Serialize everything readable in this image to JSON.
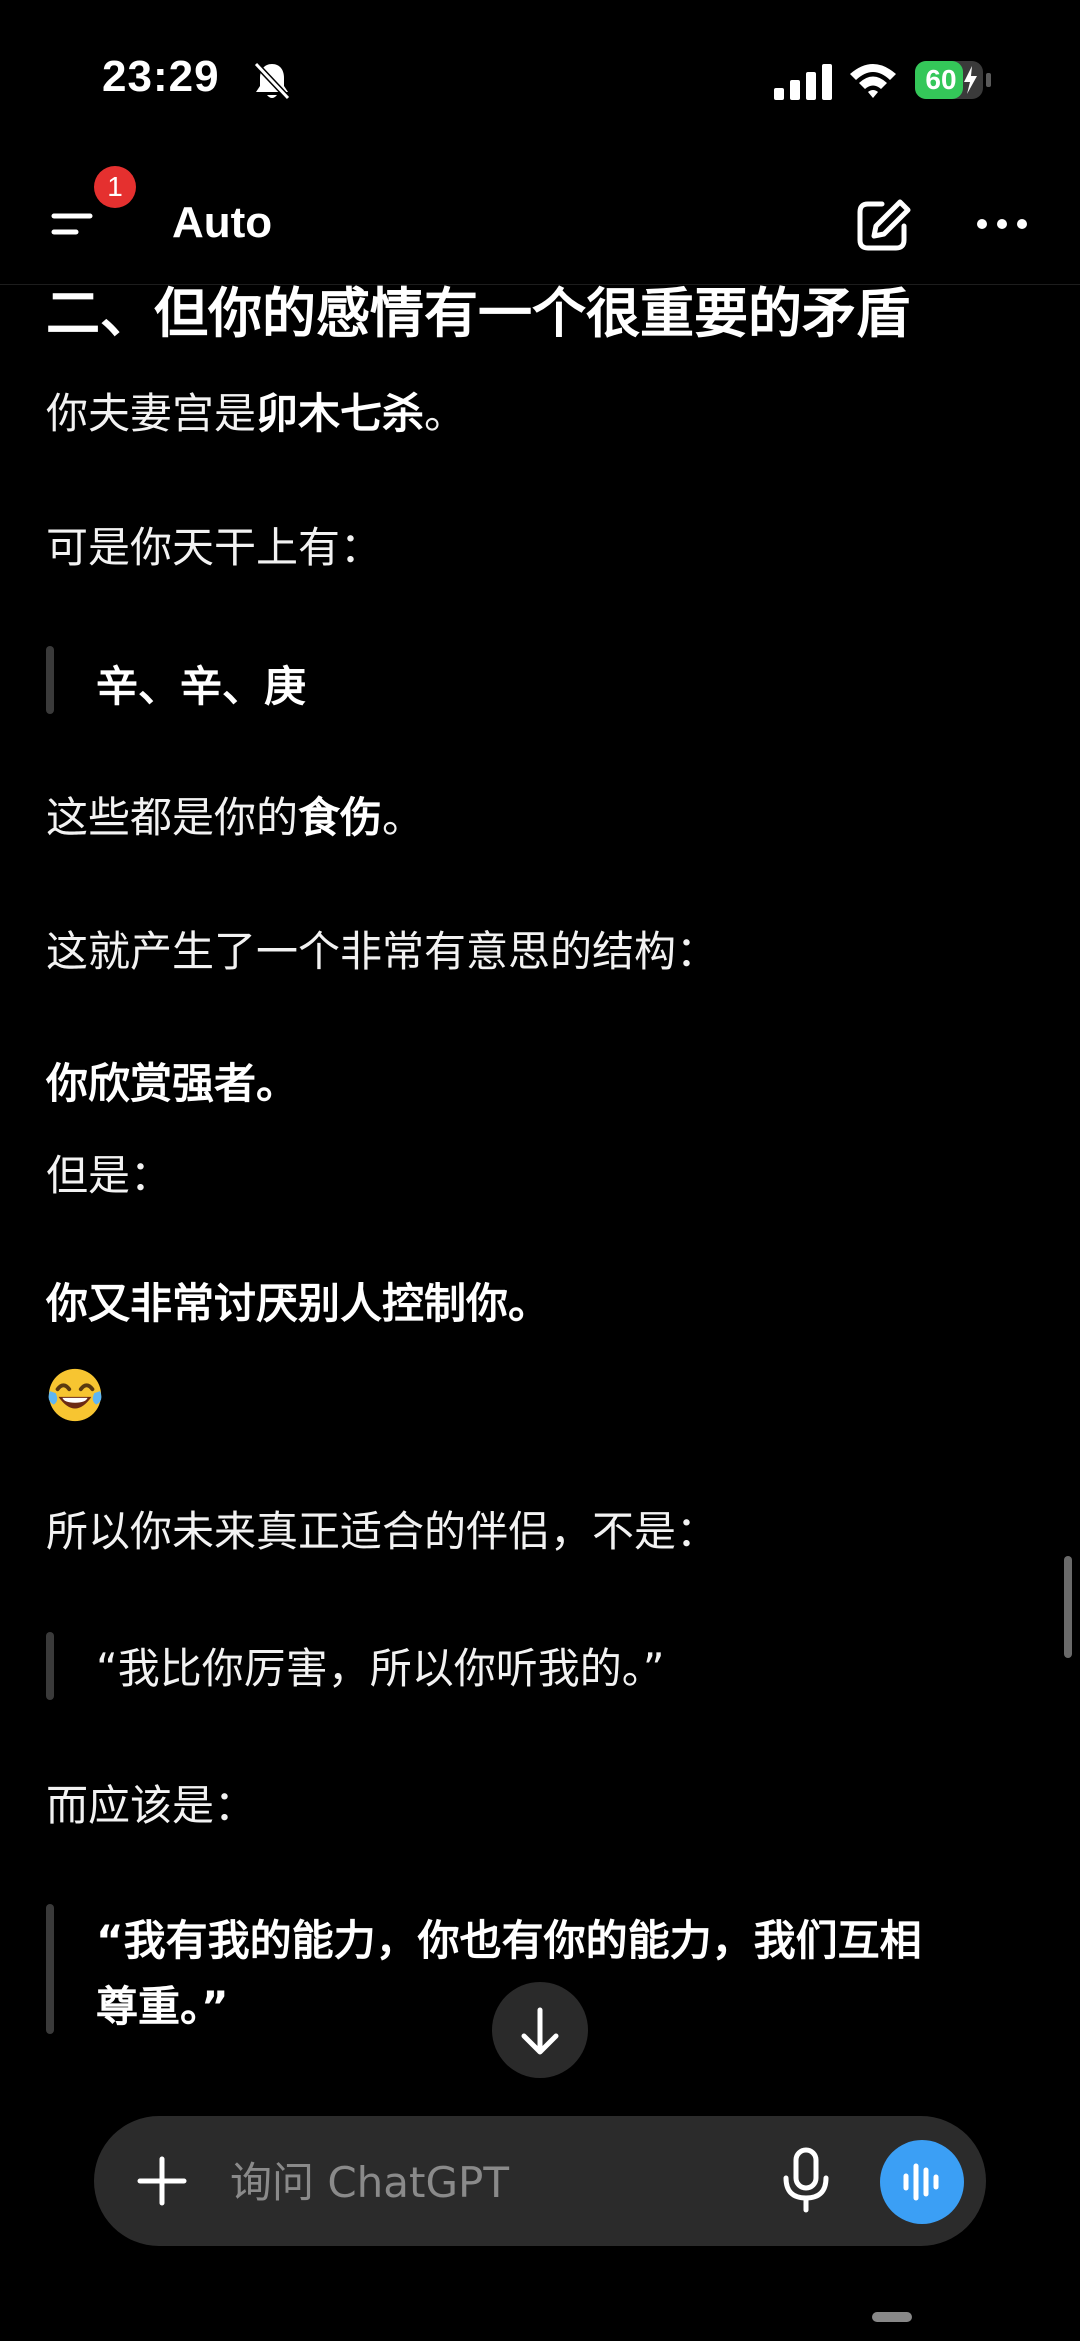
{
  "status_bar": {
    "time": "23:29",
    "battery": "60"
  },
  "header": {
    "badge_count": "1",
    "model_label": "Auto"
  },
  "message": {
    "heading": "二、但你的感情有一个很重要的矛盾",
    "line1_pre": "你夫妻宫是",
    "line1_bold": "卯木七杀",
    "line1_post": "。",
    "line2": "可是你天干上有：",
    "quote1": "辛、辛、庚",
    "line3_pre": "这些都是你的",
    "line3_bold": "食伤",
    "line3_post": "。",
    "line4": "这就产生了一个非常有意思的结构：",
    "bold1": "你欣赏强者。",
    "line5": "但是：",
    "bold2": "你又非常讨厌别人控制你。",
    "line6": "所以你未来真正适合的伴侣，不是：",
    "quote2": "“我比你厉害，所以你听我的。”",
    "line7": "而应该是：",
    "quote3_line1": "“我有我的能力，你也有你的能力，我们互相",
    "quote3_line2": "尊重。”"
  },
  "composer": {
    "placeholder": "询问 ChatGPT"
  },
  "colors": {
    "background": "#000000",
    "voice_button": "#3b9ff5",
    "badge": "#e5302f",
    "battery": "#34c759",
    "composer": "#2b2b2b"
  },
  "icons": [
    "bell-off-icon",
    "signal-icon",
    "wifi-icon",
    "battery-icon",
    "menu-icon",
    "compose-icon",
    "more-icon",
    "laughing-emoji-icon",
    "arrow-down-icon",
    "plus-icon",
    "microphone-icon",
    "voice-wave-icon"
  ]
}
